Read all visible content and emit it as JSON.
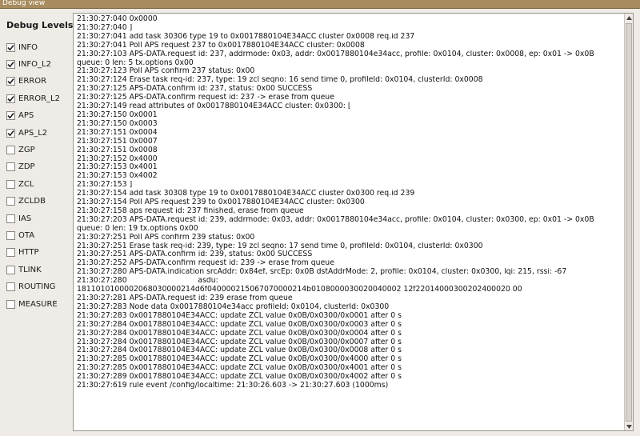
{
  "window": {
    "title": "Debug view"
  },
  "sidebar": {
    "heading": "Debug Levels",
    "levels": [
      {
        "label": "INFO",
        "checked": true
      },
      {
        "label": "INFO_L2",
        "checked": true
      },
      {
        "label": "ERROR",
        "checked": true
      },
      {
        "label": "ERROR_L2",
        "checked": true
      },
      {
        "label": "APS",
        "checked": true
      },
      {
        "label": "APS_L2",
        "checked": true
      },
      {
        "label": "ZGP",
        "checked": false
      },
      {
        "label": "ZDP",
        "checked": false
      },
      {
        "label": "ZCL",
        "checked": false
      },
      {
        "label": "ZCLDB",
        "checked": false
      },
      {
        "label": "IAS",
        "checked": false
      },
      {
        "label": "OTA",
        "checked": false
      },
      {
        "label": "HTTP",
        "checked": false
      },
      {
        "label": "TLINK",
        "checked": false
      },
      {
        "label": "ROUTING",
        "checked": false
      },
      {
        "label": "MEASURE",
        "checked": false
      }
    ]
  },
  "log": {
    "lines": [
      "21:30:27:040 0x0000",
      "21:30:27:040 ]",
      "21:30:27:041 add task 30306 type 19 to 0x0017880104E34ACC cluster 0x0008 req.id 237",
      "21:30:27:041 Poll APS request 237 to 0x0017880104E34ACC cluster: 0x0008",
      "21:30:27:103 APS-DATA.request id: 237, addrmode: 0x03, addr: 0x0017880104e34acc, profile: 0x0104, cluster: 0x0008, ep: 0x01 -> 0x0B",
      "queue: 0 len: 5 tx.options 0x00",
      "21:30:27:123 Poll APS confirm 237 status: 0x00",
      "21:30:27:124 Erase task req-id: 237, type: 19 zcl seqno: 16 send time 0, profileId: 0x0104, clusterId: 0x0008",
      "21:30:27:125 APS-DATA.confirm id: 237, status: 0x00 SUCCESS",
      "21:30:27:125 APS-DATA.confirm request id: 237 -> erase from queue",
      "21:30:27:149 read attributes of 0x0017880104E34ACC cluster: 0x0300: [",
      "21:30:27:150 0x0001",
      "21:30:27:150 0x0003",
      "21:30:27:151 0x0004",
      "21:30:27:151 0x0007",
      "21:30:27:151 0x0008",
      "21:30:27:152 0x4000",
      "21:30:27:153 0x4001",
      "21:30:27:153 0x4002",
      "21:30:27:153 ]",
      "21:30:27:154 add task 30308 type 19 to 0x0017880104E34ACC cluster 0x0300 req.id 239",
      "21:30:27:154 Poll APS request 239 to 0x0017880104E34ACC cluster: 0x0300",
      "21:30:27:158 aps request id: 237 finished, erase from queue",
      "21:30:27:203 APS-DATA.request id: 239, addrmode: 0x03, addr: 0x0017880104e34acc, profile: 0x0104, cluster: 0x0300, ep: 0x01 -> 0x0B",
      "queue: 0 len: 19 tx.options 0x00",
      "21:30:27:251 Poll APS confirm 239 status: 0x00",
      "21:30:27:251 Erase task req-id: 239, type: 19 zcl seqno: 17 send time 0, profileId: 0x0104, clusterId: 0x0300",
      "21:30:27:251 APS-DATA.confirm id: 239, status: 0x00 SUCCESS",
      "21:30:27:252 APS-DATA.confirm request id: 239 -> erase from queue",
      "21:30:27:280 APS-DATA.indication srcAddr: 0x84ef, srcEp: 0x0B dstAddrMode: 2, profile: 0x0104, cluster: 0x0300, lqi: 215, rssi: -67",
      "21:30:27:280                              asdu:",
      "1811010100002068030000214d6f040000215067070000214b0108000030020040002 12f22014000300202400020 00",
      "21:30:27:281 APS-DATA.request id: 239 erase from queue",
      "21:30:27:283 Node data 0x0017880104e34acc profileId: 0x0104, clusterId: 0x0300",
      "21:30:27:283 0x0017880104E34ACC: update ZCL value 0x0B/0x0300/0x0001 after 0 s",
      "21:30:27:284 0x0017880104E34ACC: update ZCL value 0x0B/0x0300/0x0003 after 0 s",
      "21:30:27:284 0x0017880104E34ACC: update ZCL value 0x0B/0x0300/0x0004 after 0 s",
      "21:30:27:284 0x0017880104E34ACC: update ZCL value 0x0B/0x0300/0x0007 after 0 s",
      "21:30:27:284 0x0017880104E34ACC: update ZCL value 0x0B/0x0300/0x0008 after 0 s",
      "21:30:27:285 0x0017880104E34ACC: update ZCL value 0x0B/0x0300/0x4000 after 0 s",
      "21:30:27:285 0x0017880104E34ACC: update ZCL value 0x0B/0x0300/0x4001 after 0 s",
      "21:30:27:289 0x0017880104E34ACC: update ZCL value 0x0B/0x0300/0x4002 after 0 s",
      "21:30:27:619 rule event /config/localtime: 21:30:26.603 -> 21:30:27.603 (1000ms)"
    ]
  }
}
